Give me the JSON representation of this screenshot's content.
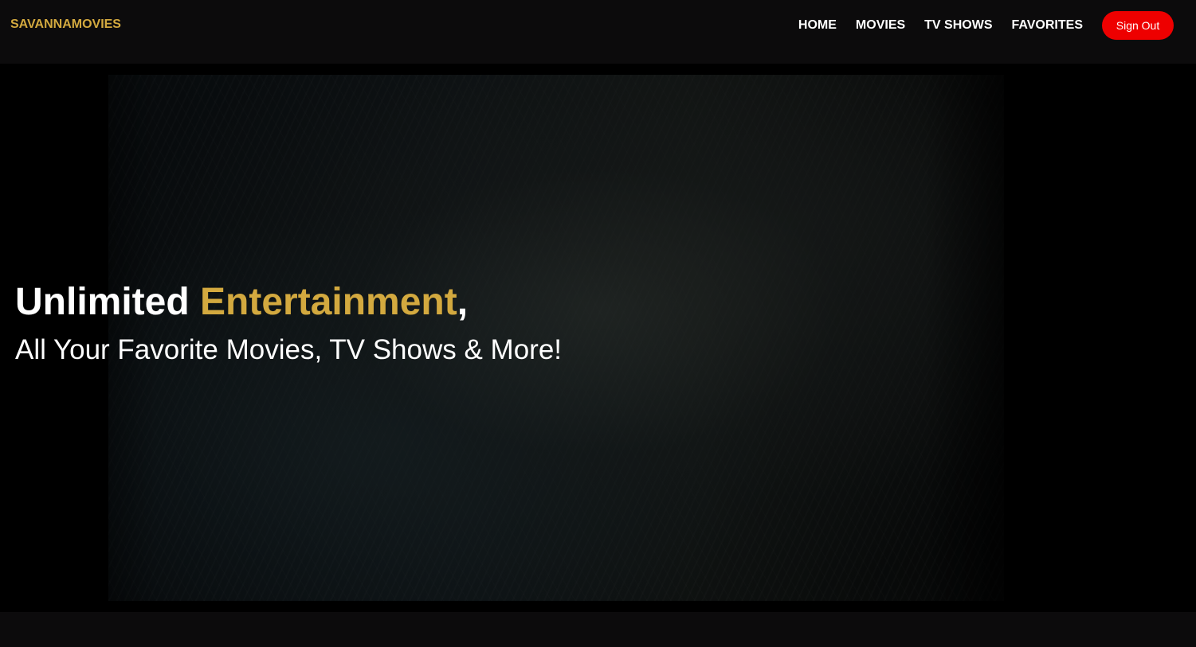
{
  "brand": {
    "name": "SAVANNAMOVIES",
    "color": "#d3a93f"
  },
  "nav": {
    "items": [
      {
        "label": "HOME"
      },
      {
        "label": "MOVIES"
      },
      {
        "label": "TV SHOWS"
      },
      {
        "label": "FAVORITES"
      }
    ],
    "signout_label": "Sign Out",
    "signout_color": "#ee0000"
  },
  "hero": {
    "headline_part1": "Unlimited ",
    "headline_accent": "Entertainment",
    "headline_part2": ",",
    "subline": "All Your Favorite Movies, TV Shows & More!"
  }
}
